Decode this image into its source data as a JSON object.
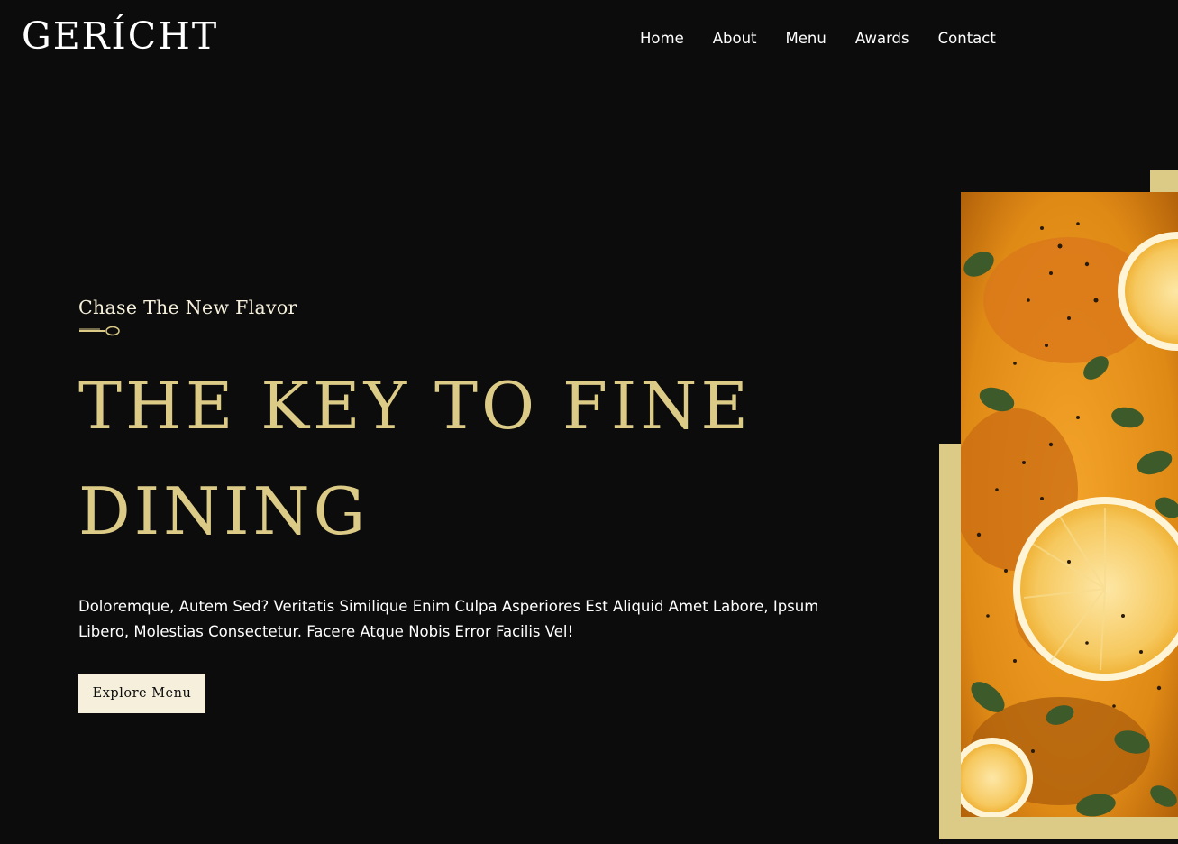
{
  "brand": {
    "logo": "GERÍCHT"
  },
  "nav": {
    "items": [
      {
        "label": "Home"
      },
      {
        "label": "About"
      },
      {
        "label": "Menu"
      },
      {
        "label": "Awards"
      },
      {
        "label": "Contact"
      }
    ]
  },
  "hero": {
    "subtitle": "Chase The New Flavor",
    "headline_line1": "THE KEY TO FINE",
    "headline_line2": "DINING",
    "description": "Doloremque, Autem Sed? Veritatis Similique Enim Culpa Asperiores Est Aliquid Amet Labore, Ipsum Libero, Molestias Consectetur. Facere Atque Nobis Error Facilis Vel!",
    "cta_label": "Explore Menu"
  },
  "colors": {
    "background": "#0c0c0c",
    "gold": "#dcca87",
    "cream": "#f5efdb",
    "white": "#ffffff"
  },
  "icons": {
    "spoon": "spoon-icon"
  }
}
